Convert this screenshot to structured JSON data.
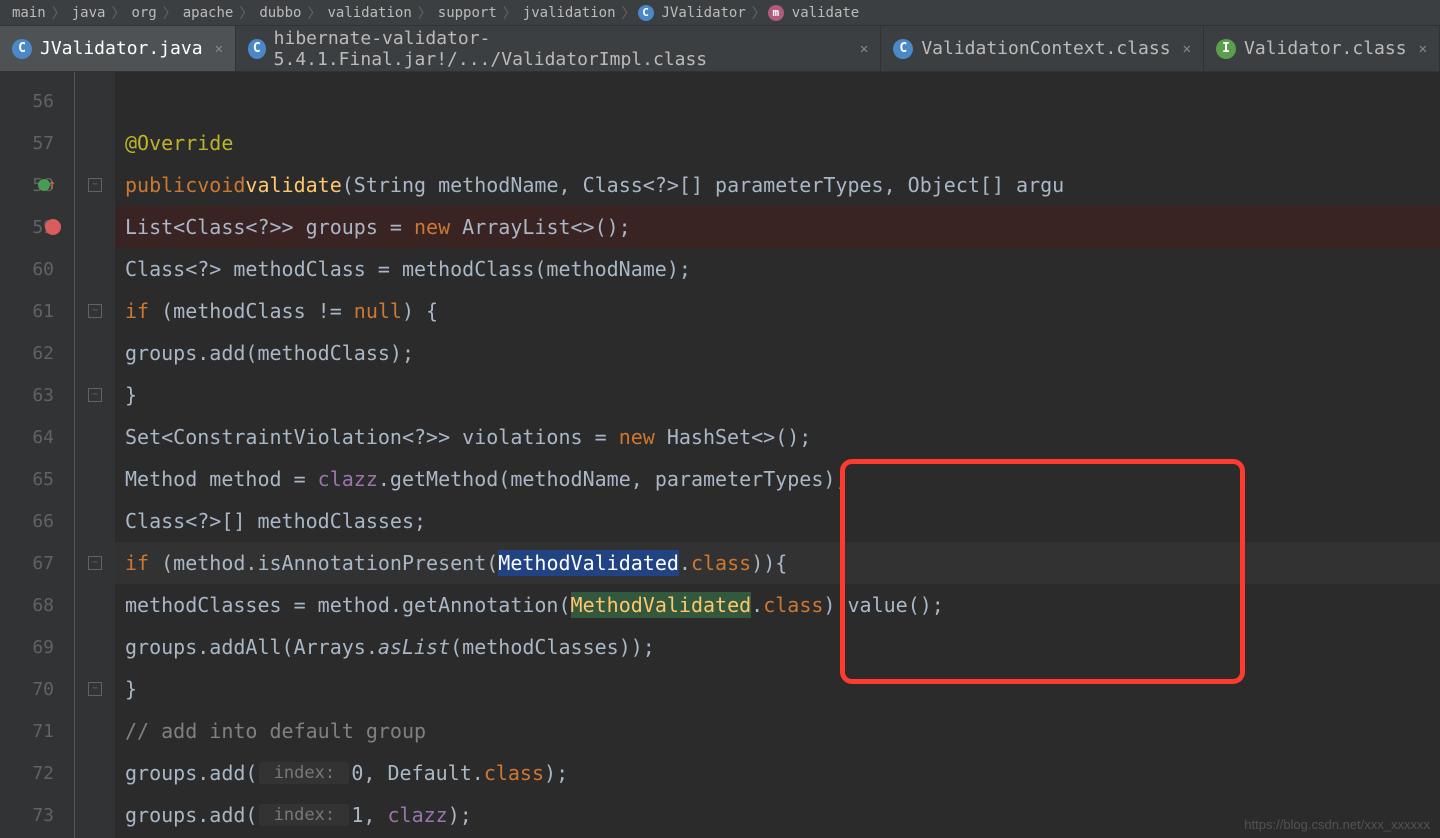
{
  "breadcrumbs": [
    "main",
    "java",
    "org",
    "apache",
    "dubbo",
    "validation",
    "support",
    "jvalidation",
    "JValidator",
    "validate"
  ],
  "tabs": [
    {
      "label": "JValidator.java",
      "icon": "C",
      "iconClass": "java-class",
      "active": true
    },
    {
      "label": "hibernate-validator-5.4.1.Final.jar!/.../ValidatorImpl.class",
      "icon": "C",
      "iconClass": "java-class",
      "active": false
    },
    {
      "label": "ValidationContext.class",
      "icon": "C",
      "iconClass": "java-class",
      "active": false
    },
    {
      "label": "Validator.class",
      "icon": "I",
      "iconClass": "java-interface",
      "active": false
    }
  ],
  "lineNumbers": [
    "56",
    "57",
    "58",
    "59",
    "60",
    "61",
    "62",
    "63",
    "64",
    "65",
    "66",
    "67",
    "68",
    "69",
    "70",
    "71",
    "72",
    "73"
  ],
  "gutterMarks": {
    "58": "override",
    "59": "breakpoint",
    "67": "bulb"
  },
  "foldMarks": {
    "58": "down",
    "61": "down",
    "63": "up",
    "67": "down",
    "70": "up"
  },
  "code": {
    "override_ann": "@Override",
    "kw_public": "public",
    "kw_void": "void",
    "m_validate": "validate",
    "sig_rest": "(String methodName, Class<?>[] parameterTypes, Object[] argu",
    "l59_a": "List<Class<?>> groups = ",
    "l59_new": "new",
    "l59_b": " ArrayList<>();",
    "l60": "Class<?> methodClass = methodClass(methodName);",
    "kw_if": "if",
    "l61_a": " (methodClass != ",
    "kw_null": "null",
    "l61_b": ") {",
    "l62": "groups.add(methodClass);",
    "brace_close": "}",
    "l64_a": "Set<ConstraintViolation<?>> violations = ",
    "l64_new": "new",
    "l64_b": " HashSet<>();",
    "l65_a": "Method method = ",
    "l65_clazz": "clazz",
    "l65_b": ".getMethod(methodName, parameterTypes);",
    "l66": "Class<?>[] methodClasses;",
    "l67_a": " (method.isAnnotationPresent(",
    "l67_mv": "MethodValidated",
    "l67_b": ".",
    "l67_class": "class",
    "l67_c": ")){",
    "l68_a": "methodClasses = method.getAnnotation(",
    "l68_mv": "MethodValidated",
    "l68_b": ".",
    "l68_class": "class",
    "l68_c": ").value();",
    "l69_a": "groups.addAll(Arrays.",
    "l69_asList": "asList",
    "l69_b": "(methodClasses));",
    "l71_cmt": "// add into default group",
    "l72_a": "groups.add(",
    "l72_hint": " index: ",
    "l72_0": "0",
    "l72_b": ", Default.",
    "l72_class": "class",
    "l72_c": ");",
    "l73_a": "groups.add(",
    "l73_hint": " index: ",
    "l73_1": "1",
    "l73_b": ", ",
    "l73_clazz": "clazz",
    "l73_c": ");"
  },
  "watermark": "https://blog.csdn.net/xxx_xxxxxx"
}
